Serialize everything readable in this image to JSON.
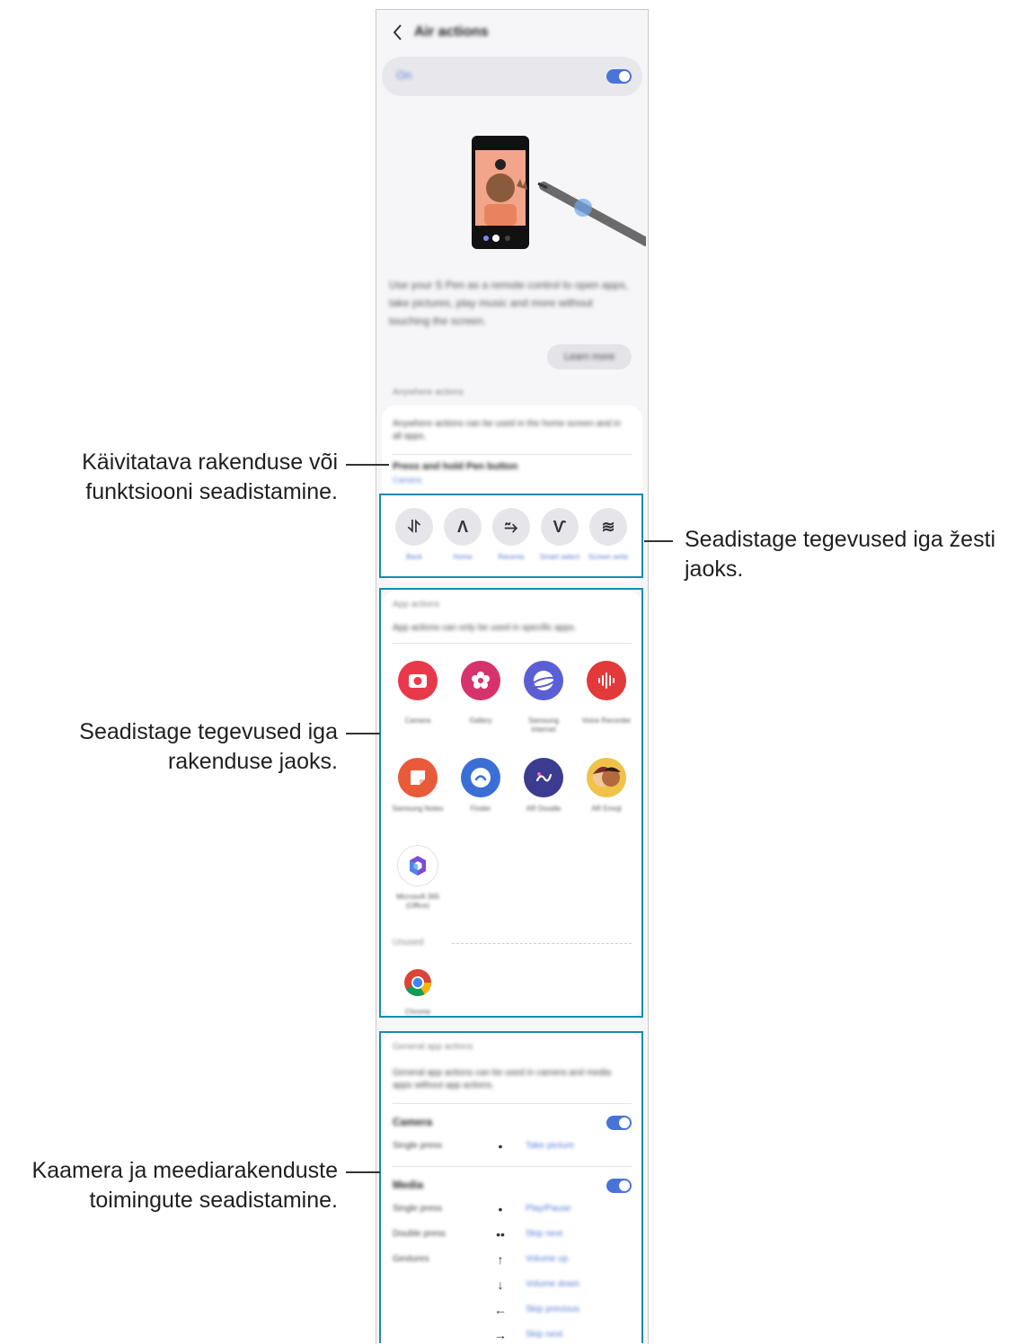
{
  "header": {
    "title": "Air actions"
  },
  "main_toggle": {
    "label": "On"
  },
  "intro": {
    "description": "Use your S Pen as a remote control to open apps, take pictures, play music and more without touching the screen.",
    "learn_more": "Learn more"
  },
  "anywhere": {
    "section_label": "Anywhere actions",
    "description": "Anywhere actions can be used in the home screen and in all apps.",
    "press_hold_title": "Press and hold Pen button",
    "press_hold_value": "Camera"
  },
  "gestures": [
    {
      "symbol": "⥯",
      "label": "Back"
    },
    {
      "symbol": "Ʌ",
      "label": "Home"
    },
    {
      "symbol": "⥲",
      "label": "Recents"
    },
    {
      "symbol": "Ѵ",
      "label": "Smart select"
    },
    {
      "symbol": "≋",
      "label": "Screen write"
    }
  ],
  "app_actions": {
    "section_label": "App actions",
    "description": "App actions can only be used in specific apps.",
    "apps": [
      {
        "name": "Camera",
        "color": "#e8394a",
        "icon": "camera-app-icon"
      },
      {
        "name": "Gallery",
        "color": "#d6336c",
        "icon": "gallery-app-icon"
      },
      {
        "name": "Samsung Internet",
        "color": "#5b5fd6",
        "icon": "internet-app-icon"
      },
      {
        "name": "Voice Recorder",
        "color": "#e23a3a",
        "icon": "voice-recorder-app-icon"
      },
      {
        "name": "Samsung Notes",
        "color": "#e85a3a",
        "icon": "notes-app-icon"
      },
      {
        "name": "Finder",
        "color": "#3b6fd6",
        "icon": "finder-app-icon"
      },
      {
        "name": "AR Doodle",
        "color": "#3b3b8f",
        "icon": "ar-doodle-app-icon"
      },
      {
        "name": "AR Emoji",
        "color": "#f0c24a",
        "icon": "ar-emoji-app-icon"
      },
      {
        "name": "Microsoft 365 (Office)",
        "color": "#ffffff",
        "icon": "office-app-icon"
      }
    ],
    "unused_label": "Unused",
    "unused_apps": [
      {
        "name": "Chrome",
        "icon": "chrome-app-icon"
      }
    ]
  },
  "general_actions": {
    "section_label": "General app actions",
    "description": "General app actions can be used in camera and media apps without app actions.",
    "camera": {
      "title": "Camera",
      "rows": [
        {
          "label": "Single press",
          "symbol": "•",
          "value": "Take picture"
        }
      ]
    },
    "media": {
      "title": "Media",
      "rows": [
        {
          "label": "Single press",
          "symbol": "•",
          "value": "Play/Pause"
        },
        {
          "label": "Double press",
          "symbol": "••",
          "value": "Skip next"
        },
        {
          "label": "Gestures",
          "symbol": "↑",
          "value": "Volume up"
        },
        {
          "label": "",
          "symbol": "↓",
          "value": "Volume down"
        },
        {
          "label": "",
          "symbol": "←",
          "value": "Skip previous"
        },
        {
          "label": "",
          "symbol": "→",
          "value": "Skip next"
        }
      ]
    }
  },
  "callouts": {
    "launch": "Käivitatava rakenduse või funktsiooni seadistamine.",
    "gestures": "Seadistage tegevused iga žesti jaoks.",
    "apps": "Seadistage tegevused iga rakenduse jaoks.",
    "media": "Kaamera ja meediarakenduste toimingute seadistamine."
  },
  "colors": {
    "accent": "#4a73d9",
    "highlight": "#1a8bb3"
  }
}
